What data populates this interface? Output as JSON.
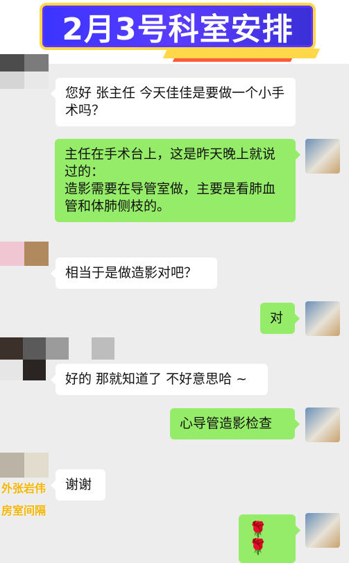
{
  "banner": {
    "title": "2月3号科室安排"
  },
  "messages": [
    {
      "side": "left",
      "text": "您好 张主任 今天佳佳是要做一个小手术吗？"
    },
    {
      "side": "right",
      "text": "主任在手术台上，这是昨天晚上就说过的：\n造影需要在导管室做，主要是看肺血管和体肺侧枝的。"
    },
    {
      "side": "left",
      "text": "相当于是做造影对吧？"
    },
    {
      "side": "right",
      "text": "对"
    },
    {
      "side": "left",
      "text": "好的 那就知道了 不好意思哈 ~"
    },
    {
      "side": "right",
      "text": "心导管造影检查"
    },
    {
      "side": "left",
      "text": "谢谢"
    },
    {
      "side": "right",
      "text": "🌹🌹"
    }
  ],
  "watermark": {
    "line1": "外张岩伟",
    "line2": "房室间隔"
  }
}
